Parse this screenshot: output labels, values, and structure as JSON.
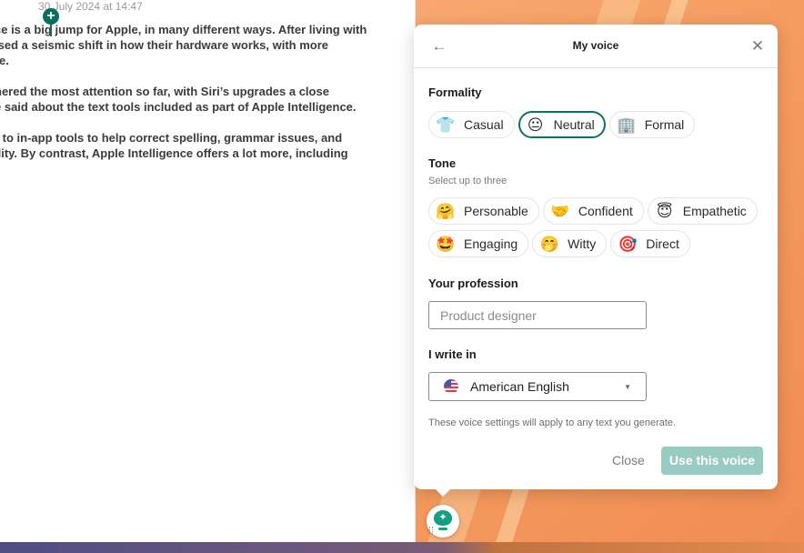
{
  "document": {
    "date": "30 July 2024 at 14:47",
    "paragraphs": [
      [
        "ce is a big jump for Apple, in many different ways. After living with",
        "ised a seismic shift in how their hardware works, with more",
        "re."
      ],
      [
        "hered the most attention so far, with Siri’s upgrades a close",
        "e said about the text tools included as part of Apple Intelligence."
      ],
      [
        "r to in-app tools to help correct spelling, grammar issues, and",
        "ility. By contrast, Apple Intelligence offers a lot more, including"
      ]
    ]
  },
  "panel": {
    "title": "My voice",
    "back_icon": "←",
    "close_icon": "✕",
    "formality": {
      "label": "Formality",
      "options": [
        {
          "label": "Casual",
          "emoji": "👕",
          "icon": "tshirt-icon",
          "selected": false
        },
        {
          "label": "Neutral",
          "emoji": "😐",
          "icon": "neutral-face-icon",
          "selected": true
        },
        {
          "label": "Formal",
          "emoji": "🏢",
          "icon": "office-building-icon",
          "selected": false
        }
      ]
    },
    "tone": {
      "label": "Tone",
      "sublabel": "Select up to three",
      "options": [
        {
          "label": "Personable",
          "emoji": "🤗",
          "icon": "hugging-face-icon"
        },
        {
          "label": "Confident",
          "emoji": "🤝",
          "icon": "handshake-icon"
        },
        {
          "label": "Empathetic",
          "emoji": "😇",
          "icon": "halo-face-icon"
        },
        {
          "label": "Engaging",
          "emoji": "🤩",
          "icon": "star-struck-icon"
        },
        {
          "label": "Witty",
          "emoji": "🤭",
          "icon": "hand-over-mouth-icon"
        },
        {
          "label": "Direct",
          "emoji": "🎯",
          "icon": "target-icon"
        }
      ]
    },
    "profession": {
      "label": "Your profession",
      "placeholder": "Product designer",
      "value": ""
    },
    "language": {
      "label": "I write in",
      "value": "American English",
      "flag": "us-flag-icon",
      "caret": "▼"
    },
    "note": "These voice settings will apply to any text you generate.",
    "buttons": {
      "close": "Close",
      "use": "Use this voice"
    }
  },
  "assistant": {
    "icon": "lightbulb-sparkle-icon",
    "spark": "✦"
  }
}
